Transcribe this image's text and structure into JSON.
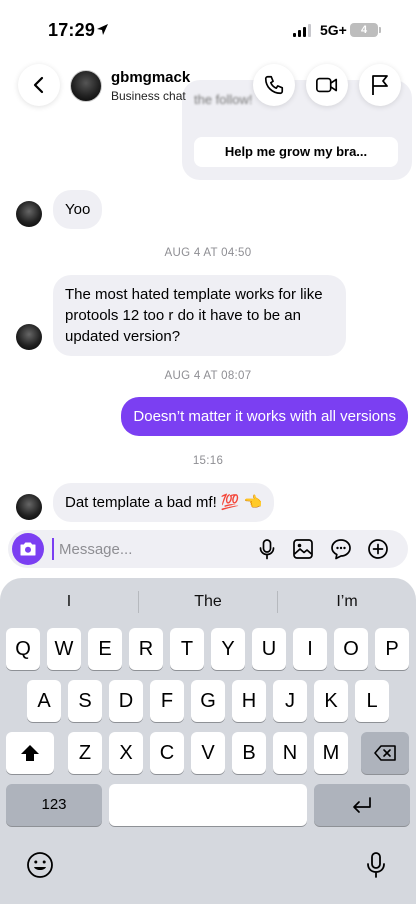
{
  "status_bar": {
    "time": "17:29",
    "network": "5G+",
    "battery": "4"
  },
  "header": {
    "name": "gbmgmack",
    "subtitle": "Business chat"
  },
  "top_card": {
    "partial_text": "the follow!",
    "button_label": "Help me grow my bra..."
  },
  "messages": [
    {
      "direction": "in",
      "text": "Yoo"
    },
    {
      "timestamp": "AUG 4 AT 04:50"
    },
    {
      "direction": "in",
      "text_lines": [
        "The most hated template works for like",
        "protools 12 too r do it have to be an",
        "updated version?"
      ]
    },
    {
      "timestamp": "AUG 4 AT 08:07"
    },
    {
      "direction": "out",
      "text": "Doesn’t matter it works with all versions"
    },
    {
      "timestamp": "15:16"
    },
    {
      "direction": "in",
      "text": "Dat template a bad mf! 💯 👈"
    }
  ],
  "composer": {
    "placeholder": "Message..."
  },
  "keyboard": {
    "suggestions": [
      "I",
      "The",
      "I’m"
    ],
    "row1": [
      "Q",
      "W",
      "E",
      "R",
      "T",
      "Y",
      "U",
      "I",
      "O",
      "P"
    ],
    "row2": [
      "A",
      "S",
      "D",
      "F",
      "G",
      "H",
      "J",
      "K",
      "L"
    ],
    "row3": [
      "Z",
      "X",
      "C",
      "V",
      "B",
      "N",
      "M"
    ],
    "numbers_key": "123"
  },
  "colors": {
    "accent": "#7b3ff2",
    "bubble_in": "#efeff4",
    "keyboard_bg": "#d5d8de"
  },
  "icons": [
    "location-arrow-icon",
    "signal-icon",
    "chevron-left-icon",
    "phone-icon",
    "video-icon",
    "flag-icon",
    "camera-icon",
    "mic-icon",
    "image-icon",
    "sticker-icon",
    "plus-circle-icon",
    "shift-icon",
    "backspace-icon",
    "return-icon",
    "emoji-icon",
    "dictation-icon"
  ]
}
